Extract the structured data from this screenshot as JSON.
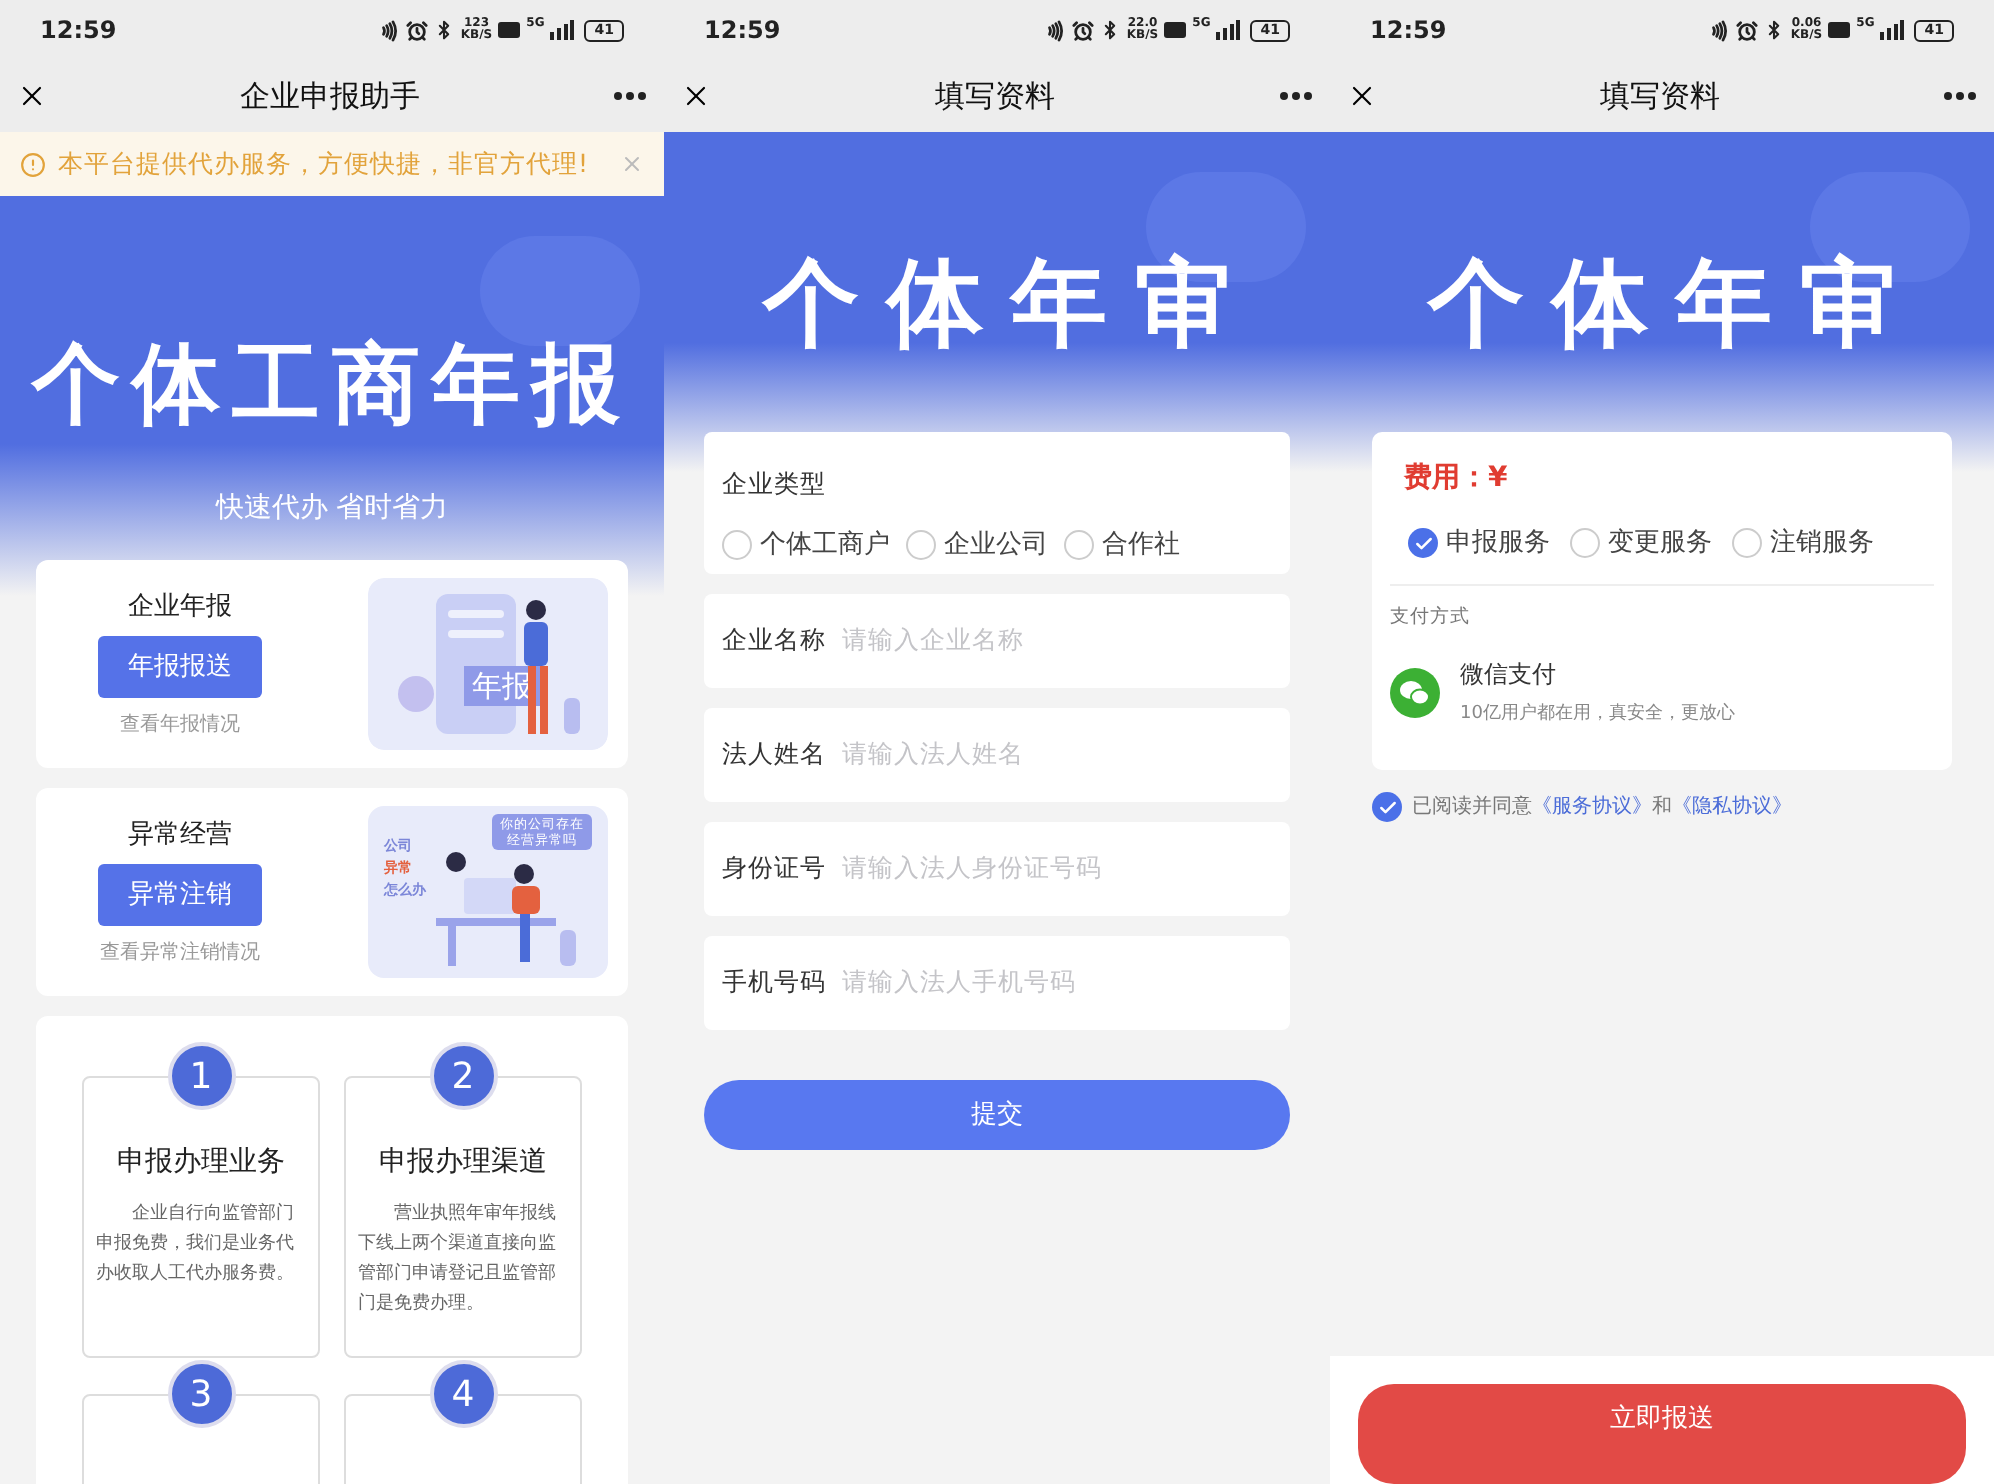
{
  "screens": [
    {
      "kind": "home",
      "status": {
        "time": "12:59",
        "speed": "123",
        "speed_unit": "KB/S",
        "network": "5G",
        "battery": "41"
      },
      "title": "企业申报助手",
      "notice": {
        "text": "本平台提供代办服务，方便快捷，非官方代理!"
      },
      "hero": {
        "title": "个体工商年报",
        "subtitle": "快速代办 省时省力"
      },
      "services": [
        {
          "kind": "report",
          "heading": "企业年报",
          "button": "年报报送",
          "link": "查看年报情况",
          "badge": "年报"
        },
        {
          "kind": "abnormal",
          "heading": "异常经营",
          "button": "异常注销",
          "link": "查看异常注销情况",
          "bubble": "你的公司存在经营异常吗",
          "tags": [
            "公司",
            "异常",
            "怎么办"
          ]
        }
      ],
      "steps": [
        {
          "number": "1",
          "title": "申报办理业务",
          "text": "企业自行向监管部门申报免费，我们是业务代办收取人工代办服务费。"
        },
        {
          "number": "2",
          "title": "申报办理渠道",
          "text": "营业执照年审年报线下线上两个渠道直接向监管部门申请登记且监管部门是免费办理。"
        },
        {
          "number": "3"
        },
        {
          "number": "4"
        }
      ]
    },
    {
      "kind": "form",
      "status": {
        "time": "12:59",
        "speed": "22.0",
        "speed_unit": "KB/S",
        "network": "5G",
        "battery": "41"
      },
      "title": "填写资料",
      "hero": {
        "title": "个体年审"
      },
      "type_group": {
        "label": "企业类型",
        "options": [
          {
            "label": "个体工商户",
            "selected": false
          },
          {
            "label": "企业公司",
            "selected": false
          },
          {
            "label": "合作社",
            "selected": false
          }
        ]
      },
      "fields": [
        {
          "label": "企业名称",
          "placeholder": "请输入企业名称"
        },
        {
          "label": "法人姓名",
          "placeholder": "请输入法人姓名"
        },
        {
          "label": "身份证号",
          "placeholder": "请输入法人身份证号码"
        },
        {
          "label": "手机号码",
          "placeholder": "请输入法人手机号码"
        }
      ],
      "submit": "提交"
    },
    {
      "kind": "payment",
      "status": {
        "time": "12:59",
        "speed": "0.06",
        "speed_unit": "KB/S",
        "network": "5G",
        "battery": "41"
      },
      "title": "填写资料",
      "hero": {
        "title": "个体年审"
      },
      "fee": "费用：¥",
      "services": [
        {
          "label": "申报服务",
          "selected": true
        },
        {
          "label": "变更服务",
          "selected": false
        },
        {
          "label": "注销服务",
          "selected": false
        }
      ],
      "pay_heading": "支付方式",
      "pay_method": {
        "name": "微信支付",
        "note": "10亿用户都在用，真安全，更放心"
      },
      "agreement": {
        "checked": true,
        "before": "已阅读并同意",
        "link1": "《服务协议》",
        "middle": "和",
        "link2": "《隐私协议》"
      },
      "action": "立即报送"
    }
  ]
}
